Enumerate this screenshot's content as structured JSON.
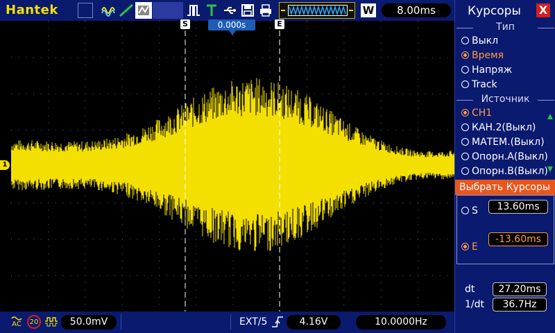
{
  "brand": "Hantek",
  "timebase": "8.00ms",
  "w_badge": "W",
  "trigger_time": "0.000s",
  "ch1_marker": "1",
  "cursor_s_label": "S",
  "cursor_e_label": "E",
  "panel": {
    "title": "Курсоры",
    "close_label": "X",
    "type_group": "Тип",
    "type_options": [
      {
        "label": "Выкл",
        "selected": false
      },
      {
        "label": "Время",
        "selected": true
      },
      {
        "label": "Напряж",
        "selected": false
      },
      {
        "label": "Track",
        "selected": false
      }
    ],
    "source_group": "Источник",
    "source_options": [
      {
        "label": "CH1",
        "selected": true
      },
      {
        "label": "КАН.2(Выкл)",
        "selected": false
      },
      {
        "label": "МАТЕМ.(Выкл)",
        "selected": false
      },
      {
        "label": "Опорн.А(Выкл)",
        "selected": false
      },
      {
        "label": "Опорн.В(Выкл)",
        "selected": false
      }
    ],
    "select_label": "Выбрать  Курсоры",
    "s_label": "S",
    "s_value": "13.60ms",
    "e_label": "E",
    "e_value": "-13.60ms",
    "dt_label": "dt",
    "dt_value": "27.20ms",
    "inv_dt_label": "1/dt",
    "inv_dt_value": "36.7Hz"
  },
  "bottom": {
    "coupling": "AC",
    "bw_limit": "20",
    "ch1_scale": "50.0mV",
    "trigger_source": "EXT/5",
    "trigger_level": "4.16V",
    "frequency": "10.0000Hz"
  },
  "colors": {
    "trace": "#f4e000",
    "background": "#000000",
    "bar": "#0a1a6e",
    "selected": "#ff9a4a",
    "highlight": "#e8561c"
  }
}
